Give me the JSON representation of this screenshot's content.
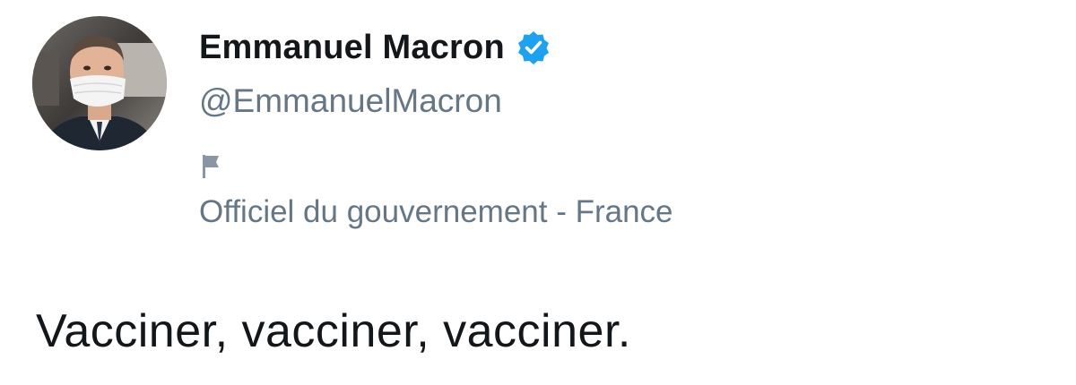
{
  "author": {
    "display_name": "Emmanuel Macron",
    "handle": "@EmmanuelMacron",
    "verified": true,
    "verified_icon": "verified-badge-icon",
    "avatar_icon": "profile-avatar"
  },
  "account_label": {
    "icon": "flag-icon",
    "text": "Officiel du gouvernement - France"
  },
  "tweet": {
    "text": "Vacciner, vacciner, vacciner."
  },
  "colors": {
    "verified_blue": "#1da1f2",
    "primary_text": "#14171a",
    "secondary_text": "#657786"
  }
}
